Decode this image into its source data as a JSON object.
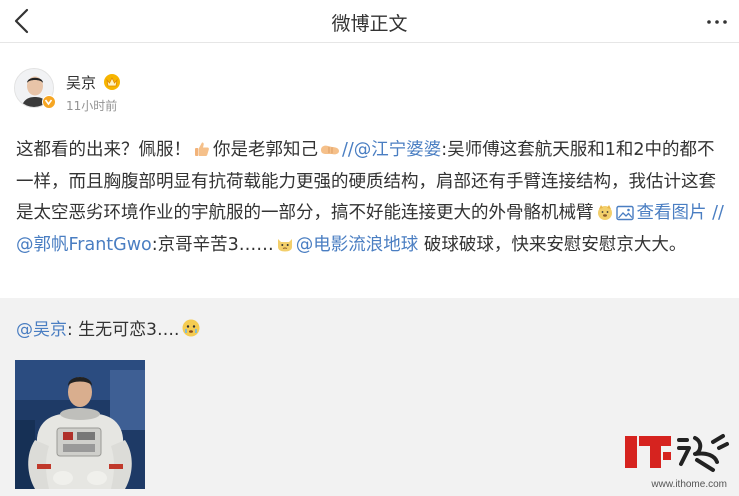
{
  "nav": {
    "title": "微博正文",
    "back_icon": "chevron-left-icon",
    "more_icon": "more-dots-icon"
  },
  "post": {
    "author": "吴京",
    "time": "11小时前",
    "verified_color": "#f6a623",
    "link_color": "#4a7ec2",
    "text": {
      "p1": "这都看的出来？佩服！",
      "p2": "你是老郭知己",
      "p3": "//",
      "mention1": "@江宁婆婆",
      "p4": ":吴师傅这套航天服和1和2中的都不一样，而且胸腹部明显有抗荷载能力更强的硬质结构，肩部还有手臂连接结构，我估计这套是太空恶劣环境作业的宇航服的一部分，搞不好能连接更大的外骨骼机械臂",
      "view_image": "查看图片",
      "p5": " //",
      "mention2": "@郭帆FrantGwo",
      "p6": ":京哥辛苦3……",
      "mention3": "@电影流浪地球",
      "p7": " 破球破球，快来安慰安慰京大大。"
    }
  },
  "repost": {
    "mention": "@吴京",
    "text": ": 生无可恋3….",
    "photo_icon": "astronaut-photo"
  },
  "watermark": {
    "logo": "IT之家",
    "url": "www.ithome.com"
  }
}
